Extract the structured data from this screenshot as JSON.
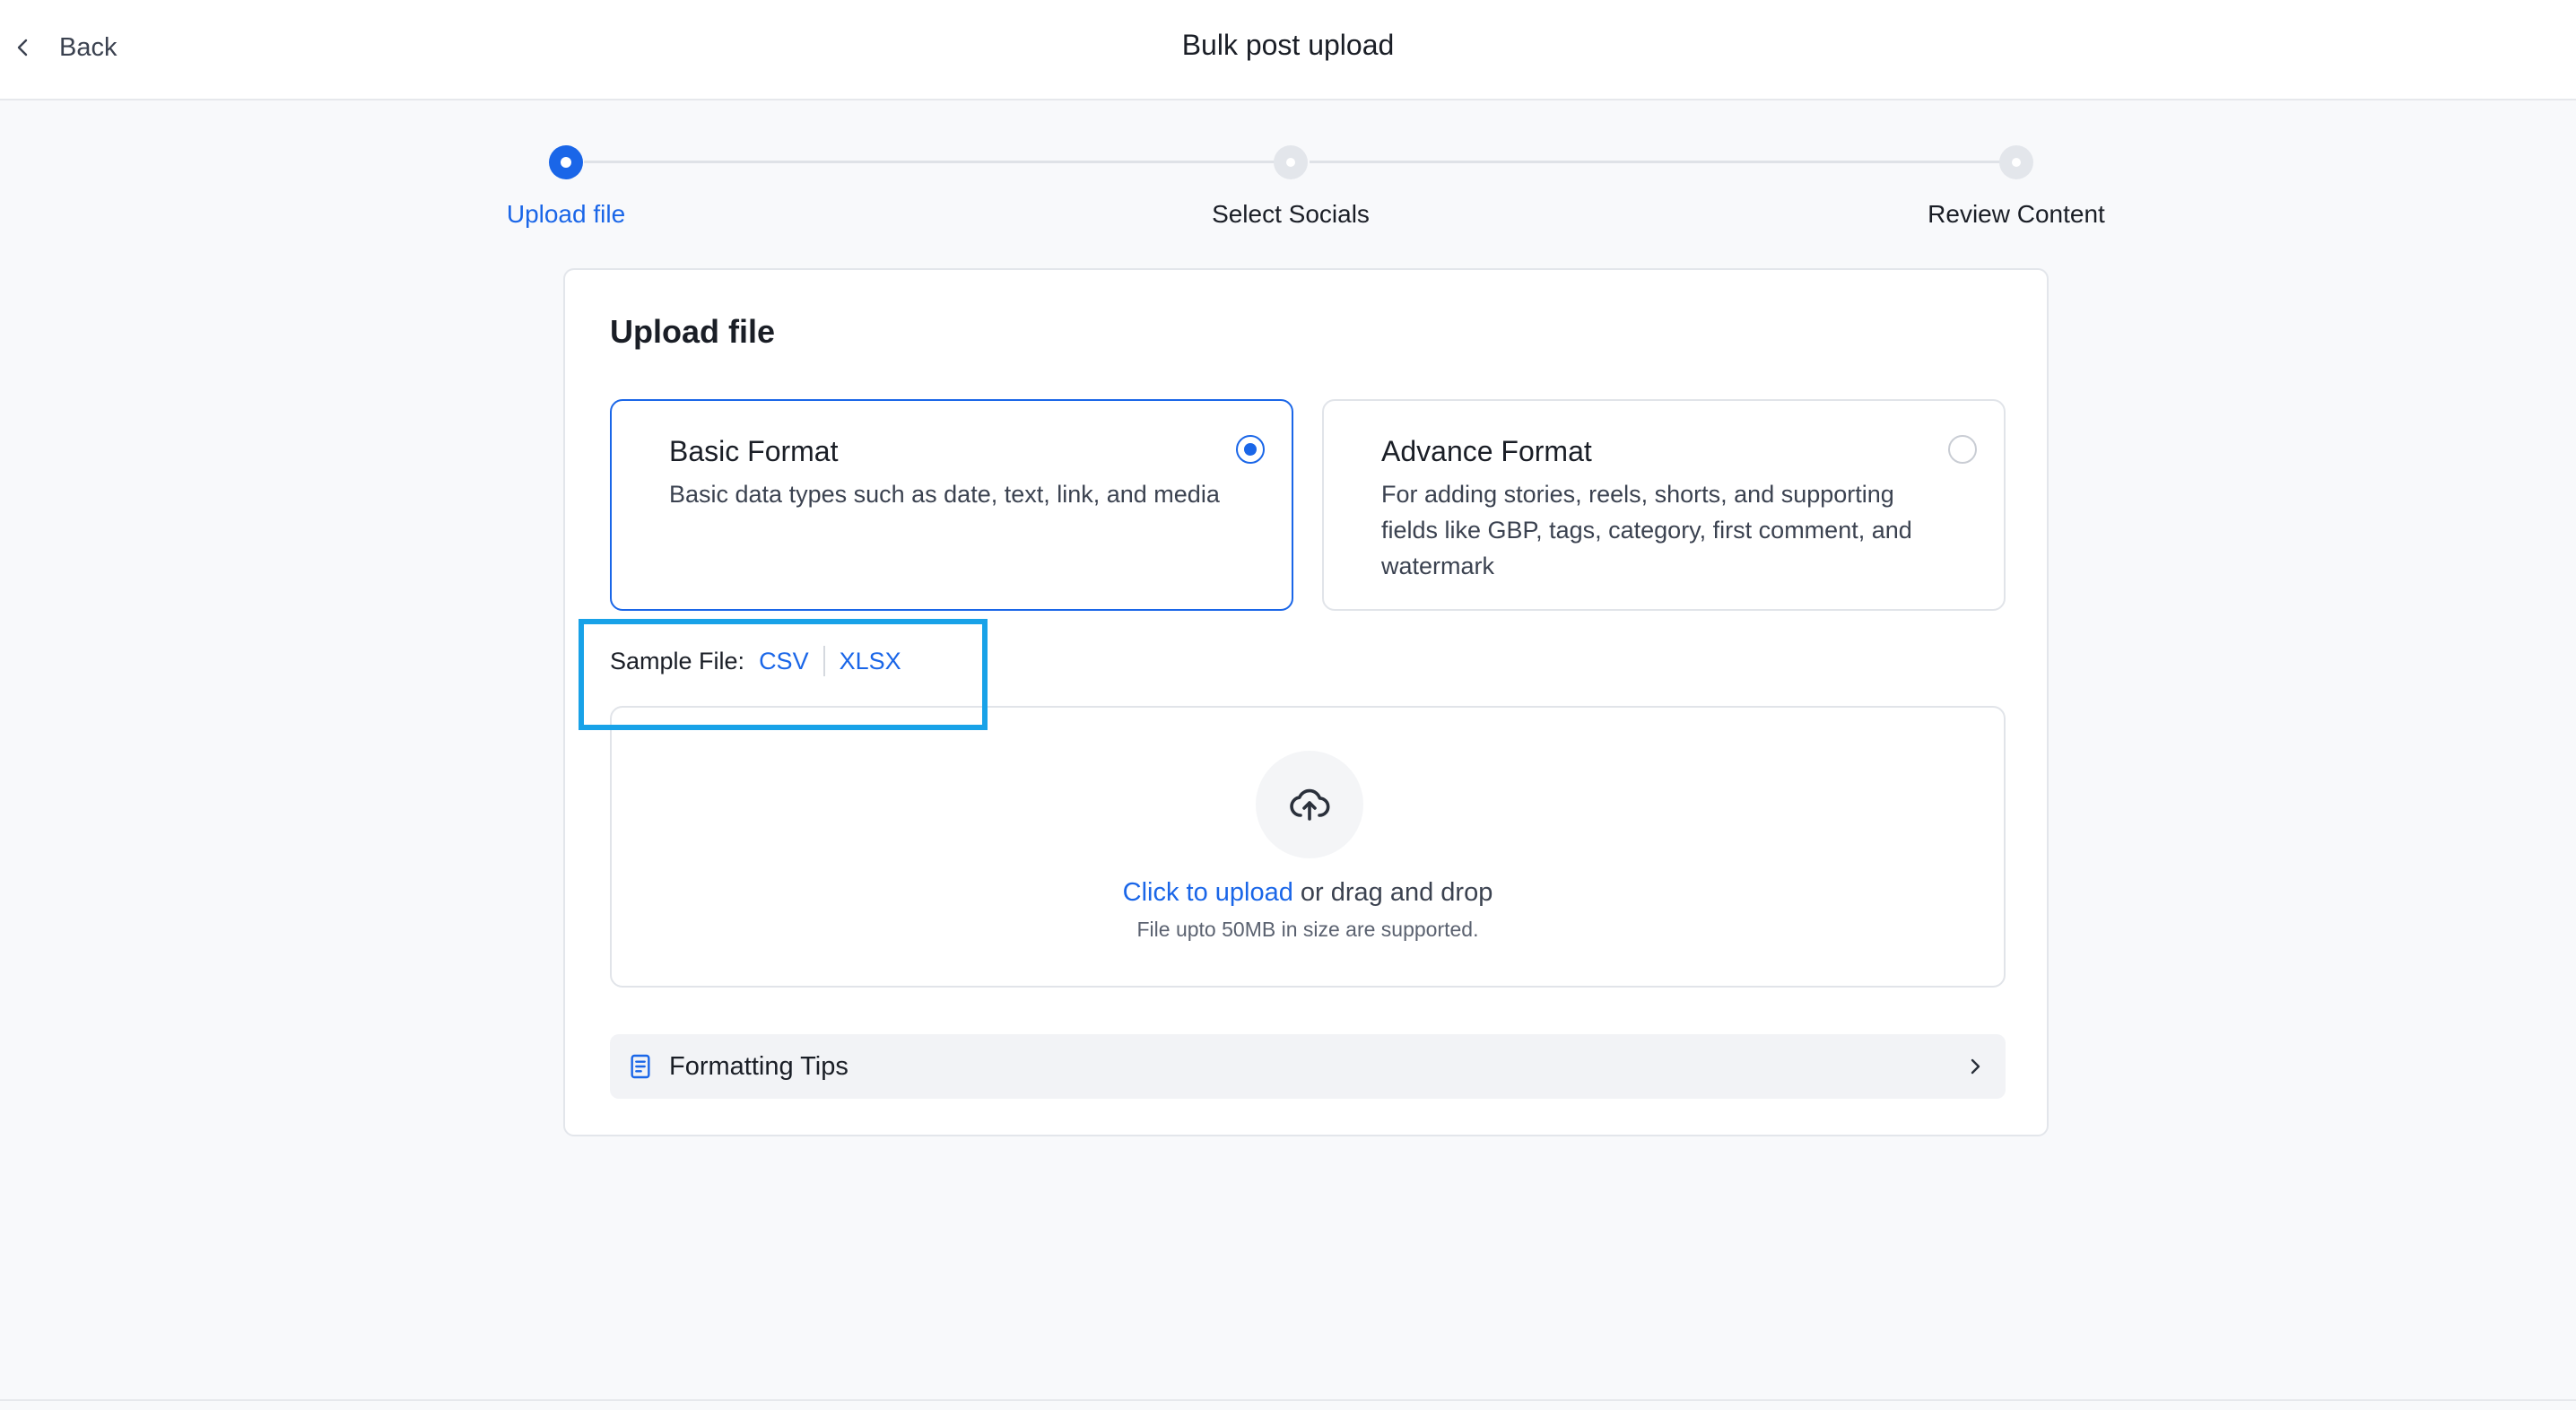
{
  "header": {
    "back_label": "Back",
    "title": "Bulk post upload"
  },
  "stepper": {
    "steps": [
      {
        "label": "Upload file",
        "state": "active"
      },
      {
        "label": "Select Socials",
        "state": "inactive"
      },
      {
        "label": "Review Content",
        "state": "inactive"
      }
    ]
  },
  "card": {
    "title": "Upload file",
    "formats": [
      {
        "title": "Basic Format",
        "description": "Basic data types such as date, text, link, and media",
        "selected": true
      },
      {
        "title": "Advance Format",
        "description": "For adding stories, reels, shorts, and supporting fields like GBP, tags, category, first comment, and watermark",
        "selected": false
      }
    ],
    "sample": {
      "label": "Sample File:",
      "csv": "CSV",
      "xlsx": "XLSX"
    },
    "dropzone": {
      "link_text": "Click to upload",
      "rest_text": " or drag and drop",
      "sub_text": "File upto 50MB in size are supported."
    },
    "tips_label": "Formatting Tips"
  },
  "colors": {
    "accent": "#1a66e8",
    "highlight": "#18a2e8"
  },
  "icons": {
    "back": "chevron-left-icon",
    "upload": "cloud-upload-icon",
    "tips": "document-icon",
    "tips_chevron": "chevron-right-icon"
  }
}
